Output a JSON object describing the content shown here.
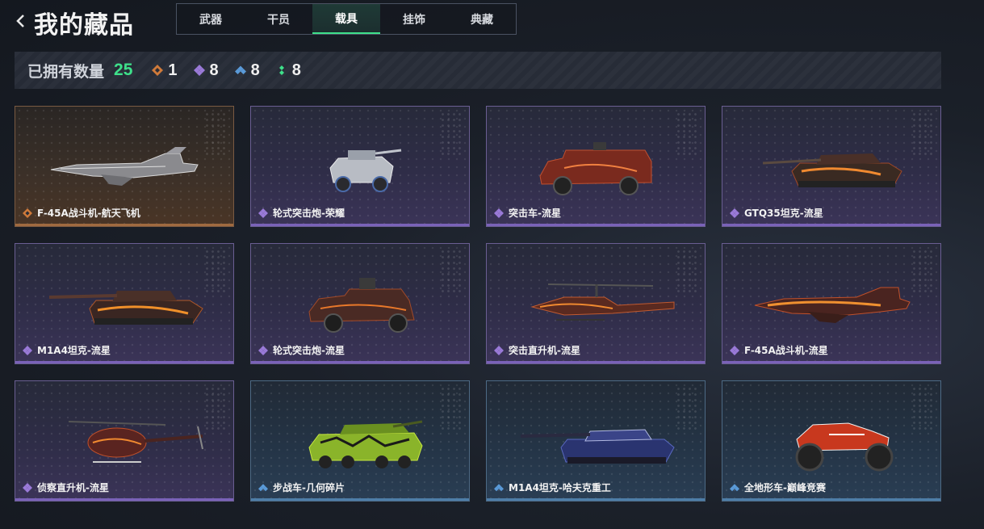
{
  "header": {
    "title": "我的藏品",
    "tabs": [
      {
        "label": "武器",
        "active": false
      },
      {
        "label": "干员",
        "active": false
      },
      {
        "label": "载具",
        "active": true
      },
      {
        "label": "挂饰",
        "active": false
      },
      {
        "label": "典藏",
        "active": false
      }
    ]
  },
  "stats": {
    "label": "已拥有数量",
    "total": "25",
    "legend_count": "1",
    "epic_count": "8",
    "rare_count": "8",
    "common_count": "8"
  },
  "colors": {
    "accent": "#3ee08a",
    "legend": "#d07a3a",
    "epic": "#9a7ad8",
    "rare": "#5a9ad8",
    "common": "#3ee08a"
  },
  "items": [
    {
      "name": "F-45A战斗机-航天飞机",
      "rarity": "legend",
      "icon": "jet-fighter"
    },
    {
      "name": "轮式突击炮-荣耀",
      "rarity": "epic",
      "icon": "wheeled-assault-gun"
    },
    {
      "name": "突击车-流星",
      "rarity": "epic",
      "icon": "assault-vehicle"
    },
    {
      "name": "GTQ35坦克-流星",
      "rarity": "epic",
      "icon": "tank"
    },
    {
      "name": "M1A4坦克-流星",
      "rarity": "epic",
      "icon": "tank"
    },
    {
      "name": "轮式突击炮-流星",
      "rarity": "epic",
      "icon": "wheeled-assault-gun"
    },
    {
      "name": "突击直升机-流星",
      "rarity": "epic",
      "icon": "attack-helicopter"
    },
    {
      "name": "F-45A战斗机-流星",
      "rarity": "epic",
      "icon": "jet-fighter"
    },
    {
      "name": "侦察直升机-流星",
      "rarity": "epic",
      "icon": "scout-helicopter"
    },
    {
      "name": "步战车-几何碎片",
      "rarity": "rare",
      "icon": "infantry-fighting-vehicle"
    },
    {
      "name": "M1A4坦克-哈夫克重工",
      "rarity": "rare",
      "icon": "tank"
    },
    {
      "name": "全地形车-巅峰竞赛",
      "rarity": "rare",
      "icon": "atv"
    }
  ]
}
